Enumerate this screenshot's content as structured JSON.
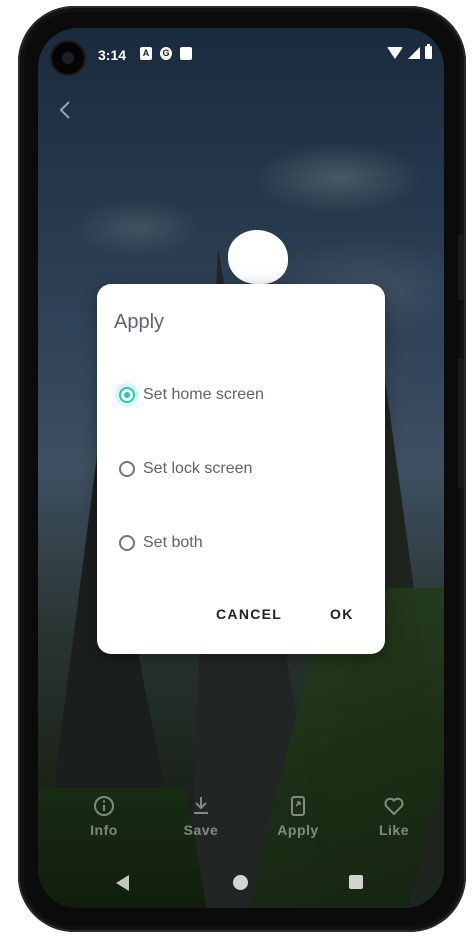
{
  "status_bar": {
    "time": "3:14",
    "left_icons": [
      "a-icon",
      "g-icon",
      "sd-icon"
    ],
    "right_icons": [
      "wifi-icon",
      "signal-icon",
      "battery-icon"
    ]
  },
  "top_nav": {
    "back_icon": "back-arrow-icon"
  },
  "dialog": {
    "title": "Apply",
    "options": [
      {
        "label": "Set home screen",
        "selected": true
      },
      {
        "label": "Set lock screen",
        "selected": false
      },
      {
        "label": "Set both",
        "selected": false
      }
    ],
    "cancel_label": "CANCEL",
    "ok_label": "OK",
    "accent_color": "#26c6b4"
  },
  "bottom_bar": {
    "items": [
      {
        "label": "Info",
        "icon": "info-icon"
      },
      {
        "label": "Save",
        "icon": "download-icon"
      },
      {
        "label": "Apply",
        "icon": "apply-icon"
      },
      {
        "label": "Like",
        "icon": "heart-icon"
      }
    ]
  },
  "nav_bar": {
    "icons": [
      "back-triangle-icon",
      "home-circle-icon",
      "recents-square-icon"
    ]
  }
}
